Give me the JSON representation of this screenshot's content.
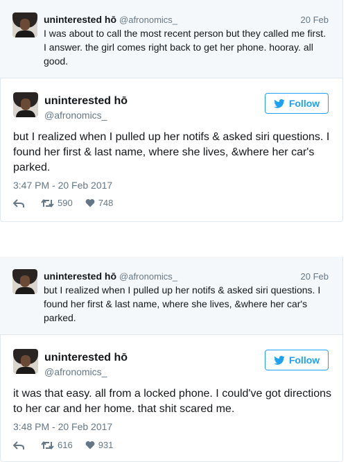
{
  "blocks": [
    {
      "quoted": {
        "name": "uninterested hō",
        "handle": "@afronomics_",
        "date": "20 Feb",
        "text": "I was about to call the most recent person but they called me first. I answer. the girl comes right back to get her phone. hooray. all good."
      },
      "main": {
        "name": "uninterested hō",
        "handle": "@afronomics_",
        "follow_label": "Follow",
        "text": "but I realized when I pulled up her notifs & asked siri questions. I found her first & last name, where she lives, &where her car's parked.",
        "timestamp": "3:47 PM - 20 Feb 2017",
        "retweets": "590",
        "likes": "748"
      }
    },
    {
      "quoted": {
        "name": "uninterested hō",
        "handle": "@afronomics_",
        "date": "20 Feb",
        "text": "but I realized when I pulled up her notifs & asked siri questions. I found her first & last name, where she lives, &where her car's parked."
      },
      "main": {
        "name": "uninterested hō",
        "handle": "@afronomics_",
        "follow_label": "Follow",
        "text": "it was that easy. all from a locked phone. I could've got directions to her car and her home. that shit scared me.",
        "timestamp": "3:48 PM - 20 Feb 2017",
        "retweets": "616",
        "likes": "931"
      }
    }
  ],
  "colors": {
    "accent": "#1da1f2",
    "muted": "#657786",
    "quoted_bg": "#f5f8fa",
    "border": "#e1e8ed"
  },
  "icons": [
    "reply-icon",
    "retweet-icon",
    "heart-icon",
    "bird-icon"
  ]
}
